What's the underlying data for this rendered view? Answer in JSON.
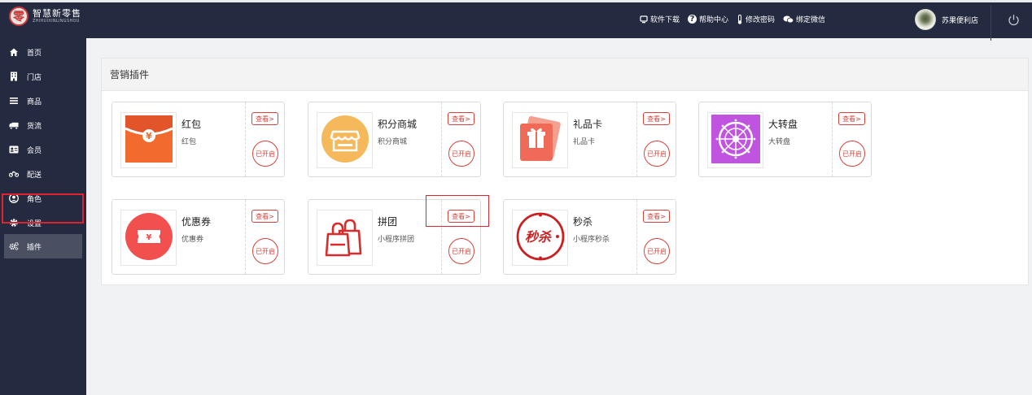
{
  "app": {
    "logo_glyph": "零",
    "logo_cn": "智慧新零售",
    "logo_en": "ZHIHUIXINLINGSHOU"
  },
  "topbar": {
    "links": [
      {
        "label": "软件下载",
        "icon": "download-icon"
      },
      {
        "label": "帮助中心",
        "icon": "help-icon"
      },
      {
        "label": "修改密码",
        "icon": "thermometer-icon"
      },
      {
        "label": "绑定微信",
        "icon": "wechat-icon"
      }
    ],
    "user_name": "苏果便利店"
  },
  "sidebar": {
    "items": [
      {
        "label": "首页",
        "icon": "home-icon"
      },
      {
        "label": "门店",
        "icon": "building-icon"
      },
      {
        "label": "商品",
        "icon": "list-icon"
      },
      {
        "label": "货流",
        "icon": "truck-icon"
      },
      {
        "label": "会员",
        "icon": "id-card-icon"
      },
      {
        "label": "配送",
        "icon": "motorcycle-icon"
      },
      {
        "label": "角色",
        "icon": "user-circle-icon"
      },
      {
        "label": "设置",
        "icon": "gear-icon"
      },
      {
        "label": "插件",
        "icon": "gears-icon",
        "active": true
      }
    ]
  },
  "main": {
    "panel_title": "营销插件",
    "view_label": "查看>",
    "status_label": "已开启",
    "plugins": [
      {
        "title": "红包",
        "subtitle": "红包",
        "icon": "red-envelope-icon"
      },
      {
        "title": "积分商城",
        "subtitle": "积分商城",
        "icon": "store-icon"
      },
      {
        "title": "礼品卡",
        "subtitle": "礼品卡",
        "icon": "gift-card-icon"
      },
      {
        "title": "大转盘",
        "subtitle": "大转盘",
        "icon": "wheel-icon"
      },
      {
        "title": "优惠券",
        "subtitle": "优惠券",
        "icon": "coupon-icon"
      },
      {
        "title": "拼团",
        "subtitle": "小程序拼团",
        "icon": "shopping-bags-icon"
      },
      {
        "title": "秒杀",
        "subtitle": "小程序秒杀",
        "icon": "flash-sale-icon",
        "icon_text": "秒杀"
      }
    ]
  },
  "colors": {
    "sidebar_bg": "#242a3f",
    "accent_red": "#d9413a",
    "highlight_red": "#e0232f"
  }
}
